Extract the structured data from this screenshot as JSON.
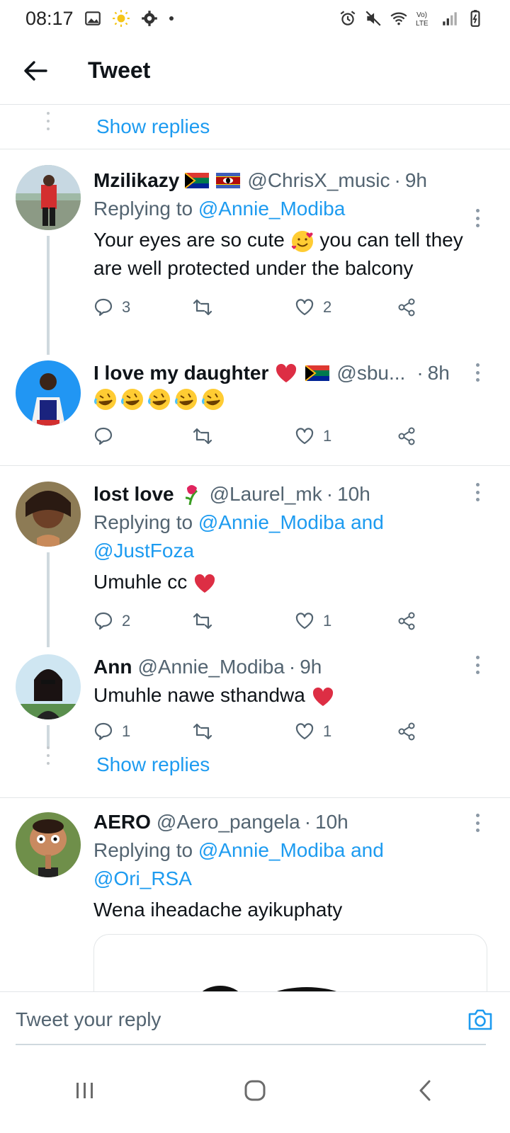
{
  "status_bar": {
    "time": "08:17"
  },
  "header": {
    "title": "Tweet"
  },
  "thread": {
    "show_replies_top": "Show replies",
    "show_replies_mid": "Show replies",
    "tweets": [
      {
        "name": "Mzilikazy",
        "handle": "@ChrisX_music",
        "time": "9h",
        "replying_label": "Replying to",
        "replying_to": "@Annie_Modiba",
        "text_a": "Your eyes are so cute",
        "text_b": "you can tell they are well protected under the balcony",
        "reply_count": "3",
        "like_count": "2"
      },
      {
        "name": "I love my daughter",
        "handle": "@sbu...",
        "time": "8h",
        "like_count": "1"
      },
      {
        "name": "lost love",
        "handle": "@Laurel_mk",
        "time": "10h",
        "replying_label": "Replying to",
        "replying_to": "@Annie_Modiba and",
        "replying_to_2": "@JustFoza",
        "text": "Umuhle cc",
        "reply_count": "2",
        "like_count": "1"
      },
      {
        "name": "Ann",
        "handle": "@Annie_Modiba",
        "time": "9h",
        "text": "Umuhle nawe sthandwa",
        "reply_count": "1",
        "like_count": "1"
      },
      {
        "name": "AERO",
        "handle": "@Aero_pangela",
        "time": "10h",
        "replying_label": "Replying to",
        "replying_to": "@Annie_Modiba and",
        "replying_to_2": "@Ori_RSA",
        "text": "Wena iheadache ayikuphaty"
      }
    ]
  },
  "composer": {
    "placeholder": "Tweet your reply"
  },
  "colors": {
    "accent": "#1d9bf0",
    "text": "#0f1419",
    "secondary": "#536471",
    "heart": "#e0245e"
  }
}
